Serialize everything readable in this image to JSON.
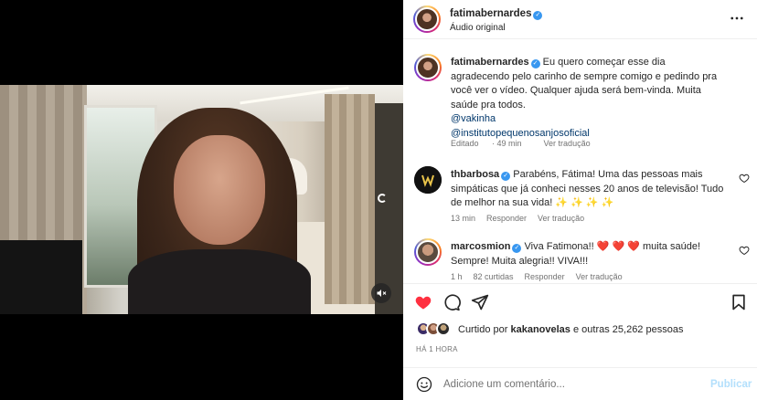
{
  "media": {
    "mute_icon": "speaker-muted-icon",
    "loading_icon": "spinner-icon"
  },
  "header": {
    "username": "fatimabernardes",
    "verified": true,
    "audio": "Áudio original",
    "more_icon": "more-horizontal-icon"
  },
  "caption": {
    "username": "fatimabernardes",
    "text": "Eu quero começar esse dia agradecendo pelo carinho de sempre comigo e pedindo pra você ver o vídeo. Qualquer ajuda será bem-vinda. Muita saúde pra todos.",
    "mention1": "@vakinha",
    "mention2": "@institutopequenosanjosoficial",
    "edited": "Editado",
    "time": "49 min",
    "translate": "Ver tradução"
  },
  "comments": [
    {
      "username": "thbarbosa",
      "text": "Parabéns, Fátima! Uma das pessoas mais simpáticas que já conheci nesses 20 anos de televisão! Tudo de melhor na sua vida! ✨ ✨ ✨ ✨",
      "time": "13 min",
      "reply": "Responder",
      "translate": "Ver tradução"
    },
    {
      "username": "marcosmion",
      "text": "Viva Fatimona!! ❤️ ❤️ ❤️ muita saúde! Sempre! Muita alegria!! VIVA!!!",
      "time": "1 h",
      "likes": "82 curtidas",
      "reply": "Responder",
      "translate": "Ver tradução"
    }
  ],
  "actions": {
    "like_icon": "heart-filled-icon",
    "comment_icon": "comment-icon",
    "share_icon": "send-icon",
    "save_icon": "bookmark-icon",
    "like_color": "#ff3040"
  },
  "likes": {
    "text_prefix": "Curtido por ",
    "user": "kakanovelas",
    "text_suffix": " e outras 25,262 pessoas"
  },
  "time_ago": "HÁ 1 HORA",
  "add_comment": {
    "placeholder": "Adicione um comentário...",
    "post_label": "Publicar"
  }
}
